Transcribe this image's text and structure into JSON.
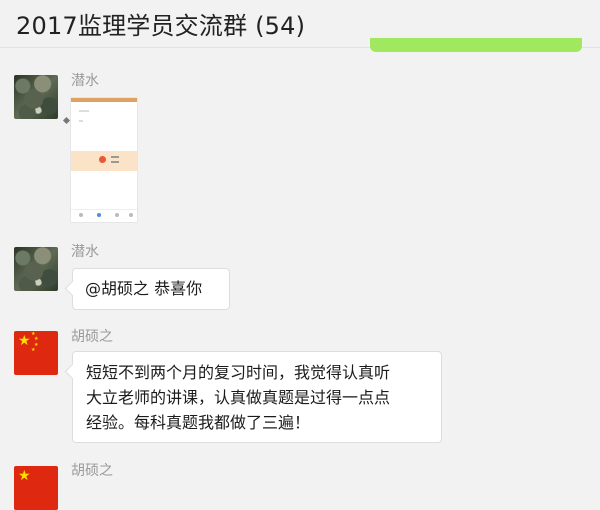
{
  "header": {
    "title": "2017监理学员交流群 (54)"
  },
  "messages": [
    {
      "sender": "潜水",
      "type": "image",
      "avatar": "rock-photo-avatar"
    },
    {
      "sender": "潜水",
      "type": "text",
      "text": "@胡硕之 恭喜你",
      "avatar": "rock-photo-avatar"
    },
    {
      "sender": "胡硕之",
      "type": "text",
      "lines": [
        "短短不到两个月的复习时间，我觉得认真听",
        "大立老师的讲课，认真做真题是过得一点点",
        "经验。每科真题我都做了三遍！"
      ],
      "avatar": "china-flag-avatar"
    },
    {
      "sender": "胡硕之",
      "type": "partial",
      "avatar": "china-flag-avatar"
    }
  ],
  "colors": {
    "background": "#f2f2f2",
    "own_bubble": "#9fe85f",
    "sender_text": "#9a9a9a",
    "flag_red": "#de2910",
    "flag_star": "#ffde00"
  }
}
